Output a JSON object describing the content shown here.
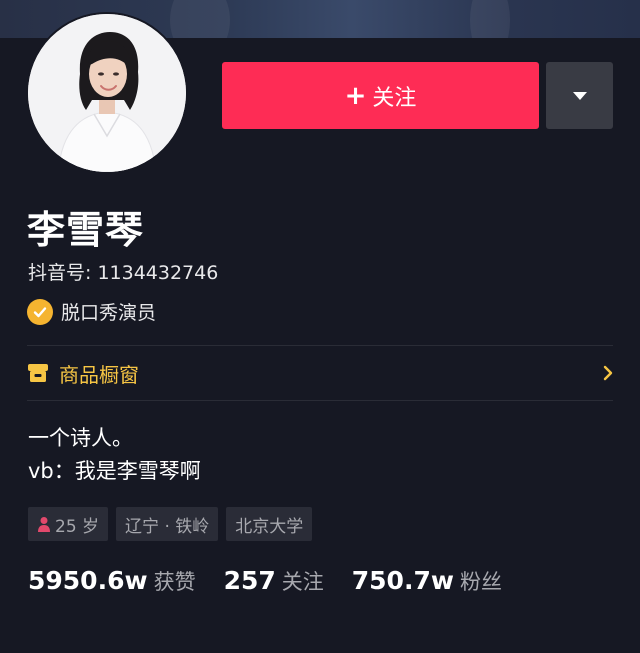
{
  "header": {
    "follow_label": "关注",
    "follow_prefix": "+"
  },
  "profile": {
    "name": "李雪琴",
    "douyin_id_label": "抖音号: 1134432746",
    "verification": "脱口秀演员"
  },
  "shop": {
    "label": "商品橱窗"
  },
  "bio": {
    "line1": "一个诗人。",
    "line2": "vb：我是李雪琴啊"
  },
  "tags": {
    "age": "25 岁",
    "location": "辽宁 · 铁岭",
    "school": "北京大学"
  },
  "stats": {
    "likes_value": "5950.6w",
    "likes_label": "获赞",
    "following_value": "257",
    "following_label": "关注",
    "followers_value": "750.7w",
    "followers_label": "粉丝"
  },
  "colors": {
    "background": "#161823",
    "follow_button": "#fe2c55",
    "verify_badge": "#f5b430",
    "shop_accent": "#f6c544",
    "female_icon": "#e2496c"
  },
  "icons": {
    "more": "triangle-down-icon",
    "verify": "checkmark-badge-icon",
    "shop": "storefront-icon",
    "chevron": "chevron-right-icon",
    "gender": "female-person-icon"
  }
}
